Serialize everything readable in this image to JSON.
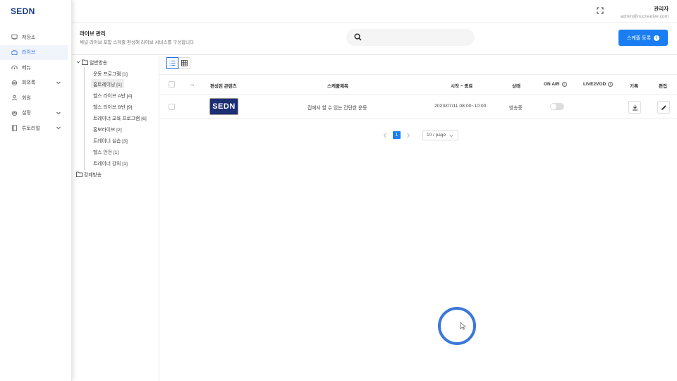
{
  "app": {
    "logo": "SEDN"
  },
  "sidebar": {
    "items": [
      {
        "label": "저장소",
        "icon": "monitor-icon",
        "has_chevron": false,
        "active": false
      },
      {
        "label": "라이브",
        "icon": "live-icon",
        "has_chevron": false,
        "active": true
      },
      {
        "label": "메뉴",
        "icon": "menu-icon",
        "has_chevron": false,
        "active": false
      },
      {
        "label": "회의록",
        "icon": "gear-icon",
        "has_chevron": true,
        "active": false
      },
      {
        "label": "회원",
        "icon": "user-icon",
        "has_chevron": false,
        "active": false
      },
      {
        "label": "설정",
        "icon": "gear-icon",
        "has_chevron": true,
        "active": false
      },
      {
        "label": "튜토리얼",
        "icon": "book-icon",
        "has_chevron": true,
        "active": false
      }
    ]
  },
  "header": {
    "user_name": "관리자",
    "user_email": "admin@nucreative.com"
  },
  "page": {
    "title": "라이브 관리",
    "subtitle": "채널 라이브 포함 스케줄 편성해 라이브 서비스를 구성합니다",
    "search_placeholder": "",
    "register_button": "스케줄 등록"
  },
  "tree": {
    "root1": "일반방송",
    "children": [
      "운동 프로그램 [1]",
      "홈트레이닝 [1]",
      "헬스 라이브 A반 [4]",
      "헬스 라이브 B반 [9]",
      "트레이너 교육 프로그램 [6]",
      "홍보라이브 [2]",
      "트레이너 실습 [3]",
      "헬스 안전 [1]",
      "트레이너 강의 [1]"
    ],
    "selected_index": 1,
    "root2": "강제방송"
  },
  "table": {
    "headers": {
      "more": "...",
      "content": "편성된 콘텐츠",
      "title": "스케줄제목",
      "time": "시작 ~ 종료",
      "status": "상태",
      "onair": "ON AIR",
      "live2vod": "LIVE2VOD",
      "record": "기록",
      "edit": "편집"
    },
    "rows": [
      {
        "thumb_text": "SEDN",
        "title": "집에서 할 수 있는 간단한 운동",
        "time": "2023/07/11 08:00~10:00",
        "status": "방송중",
        "onair": false
      }
    ]
  },
  "pagination": {
    "current": "1",
    "page_size": "10 / page"
  },
  "colors": {
    "accent": "#1a7ef2",
    "logo": "#1b3a8c",
    "thumb_bg": "#1d2e73",
    "active_nav": "#2b6fe0"
  }
}
